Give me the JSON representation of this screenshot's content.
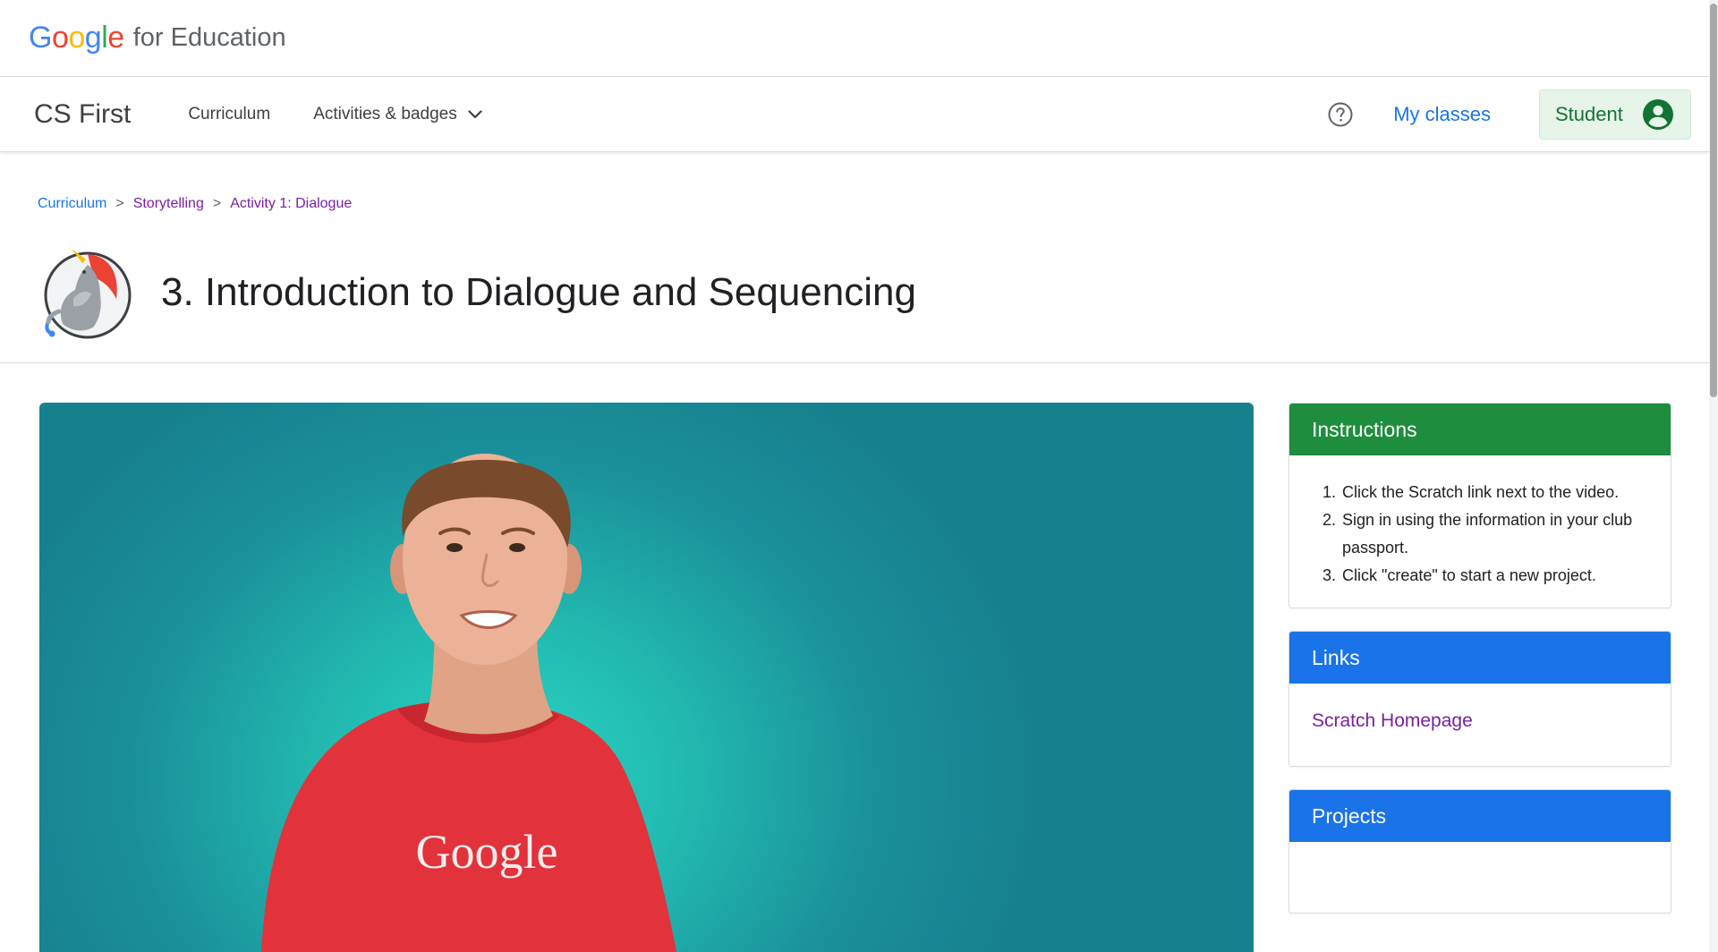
{
  "brand": {
    "google_letters": [
      {
        "ch": "G",
        "color": "#4285F4"
      },
      {
        "ch": "o",
        "color": "#EA4335"
      },
      {
        "ch": "o",
        "color": "#FBBC05"
      },
      {
        "ch": "g",
        "color": "#4285F4"
      },
      {
        "ch": "l",
        "color": "#34A853"
      },
      {
        "ch": "e",
        "color": "#EA4335"
      }
    ],
    "suffix": "for Education"
  },
  "nav": {
    "product": "CS First",
    "curriculum": "Curriculum",
    "activities": "Activities & badges",
    "activities_icon": "chevron-down-icon",
    "help_icon": "help-circle-icon",
    "my_classes": "My classes",
    "student": "Student",
    "student_icon": "account-circle-icon"
  },
  "breadcrumb": {
    "items": [
      "Curriculum",
      "Storytelling",
      "Activity 1: Dialogue"
    ],
    "separator": ">"
  },
  "page": {
    "title": "3. Introduction to Dialogue and Sequencing",
    "mascot_icon": "unicorn-mascot-icon"
  },
  "video": {
    "shirt_text": "Google"
  },
  "instructions": {
    "title": "Instructions",
    "steps": [
      {
        "num": "1.",
        "text": "Click the Scratch link next to the video."
      },
      {
        "num": "2.",
        "text": "Sign in using the information in your club passport."
      },
      {
        "num": "3.",
        "text": "Click \"create\" to start a new project."
      }
    ]
  },
  "links": {
    "title": "Links",
    "items": [
      "Scratch Homepage"
    ]
  },
  "projects": {
    "title": "Projects"
  },
  "colors": {
    "instructions_header": "#1e8e3e",
    "links_header": "#1a73e8",
    "projects_header": "#1a73e8",
    "link_visited": "#7b1fa2",
    "accent_blue": "#1a73e8",
    "student_bg": "#e6f4ea",
    "student_text": "#137333"
  }
}
